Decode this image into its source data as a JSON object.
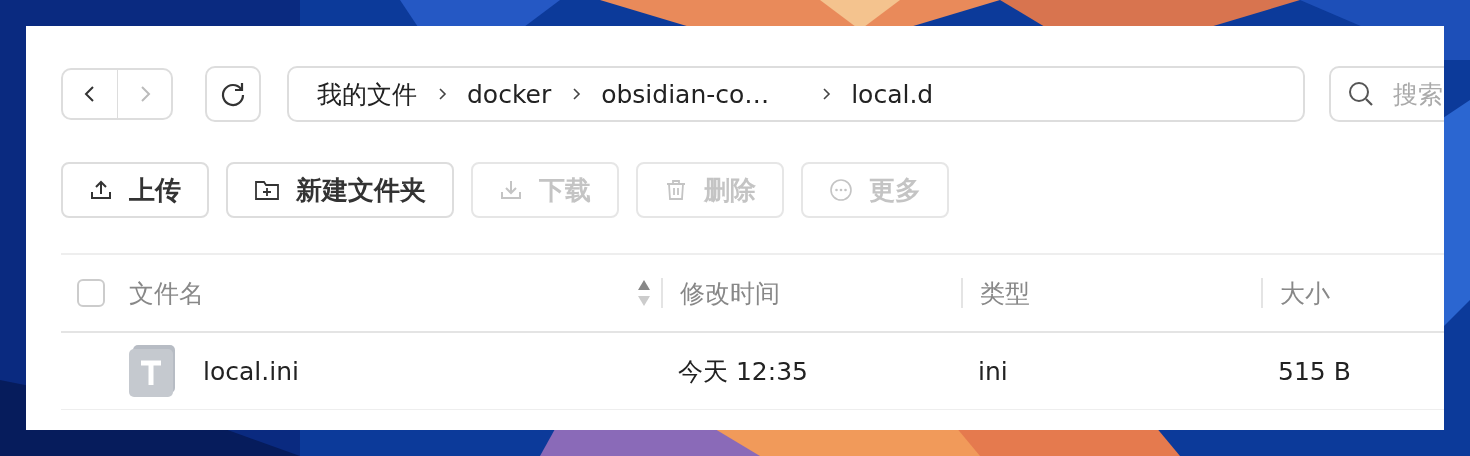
{
  "nav": {
    "back_disabled": false,
    "forward_disabled": true
  },
  "breadcrumb": [
    "我的文件",
    "docker",
    "obsidian-co…",
    "local.d"
  ],
  "search": {
    "placeholder": "搜索"
  },
  "toolbar": [
    {
      "label": "上传",
      "kind": "upload",
      "disabled": false
    },
    {
      "label": "新建文件夹",
      "kind": "folder",
      "disabled": false
    },
    {
      "label": "下载",
      "kind": "download",
      "disabled": true
    },
    {
      "label": "删除",
      "kind": "delete",
      "disabled": true
    },
    {
      "label": "更多",
      "kind": "more",
      "disabled": true
    }
  ],
  "table": {
    "select_all_checked": false,
    "columns": [
      {
        "label": "文件名",
        "sortable": true
      },
      {
        "label": "修改时间",
        "sortable": false
      },
      {
        "label": "类型",
        "sortable": false
      },
      {
        "label": "大小",
        "sortable": false
      }
    ],
    "rows": [
      {
        "name": "local.ini",
        "modified": "今天 12:35",
        "type": "ini",
        "size": "515 B"
      }
    ]
  }
}
